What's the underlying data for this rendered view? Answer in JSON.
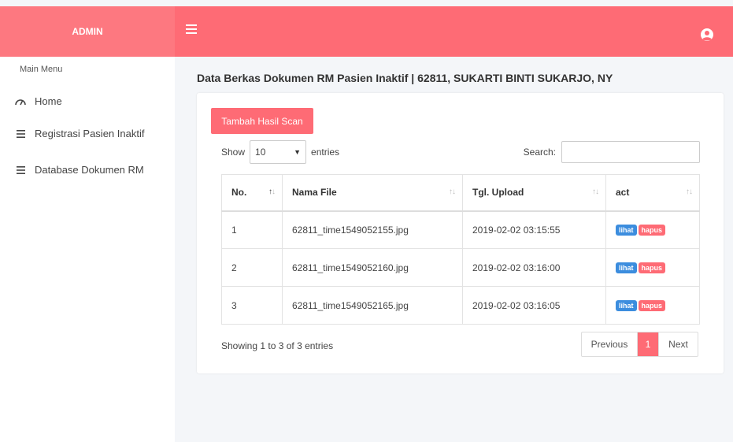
{
  "header": {
    "brand": "ADMIN",
    "menu_icon": "hamburger-icon",
    "user_icon": "user-circle-icon",
    "color": "#fe6b75"
  },
  "sidebar": {
    "section_title": "Main Menu",
    "items": [
      {
        "label": "Home",
        "icon": "dashboard-gauge-icon"
      },
      {
        "label": "Registrasi Pasien Inaktif",
        "icon": "list-icon"
      },
      {
        "label": "Database Dokumen RM",
        "icon": "list-icon"
      }
    ]
  },
  "main": {
    "title": "Data Berkas Dokumen RM Pasien Inaktif | 62811, SUKARTI BINTI SUKARJO, NY",
    "add_button": "Tambah Hasil Scan",
    "length": {
      "show": "Show",
      "value": "10",
      "entries": "entries"
    },
    "search_label": "Search:",
    "search_value": "",
    "columns": [
      "No.",
      "Nama File",
      "Tgl. Upload",
      "act"
    ],
    "rows": [
      {
        "no": "1",
        "file": "62811_time1549052155.jpg",
        "date": "2019-02-02 03:15:55"
      },
      {
        "no": "2",
        "file": "62811_time1549052160.jpg",
        "date": "2019-02-02 03:16:00"
      },
      {
        "no": "3",
        "file": "62811_time1549052165.jpg",
        "date": "2019-02-02 03:16:05"
      }
    ],
    "actions": {
      "view": "lihat",
      "delete": "hapus"
    },
    "info": "Showing 1 to 3 of 3 entries",
    "pagination": {
      "prev": "Previous",
      "current": "1",
      "next": "Next"
    }
  }
}
